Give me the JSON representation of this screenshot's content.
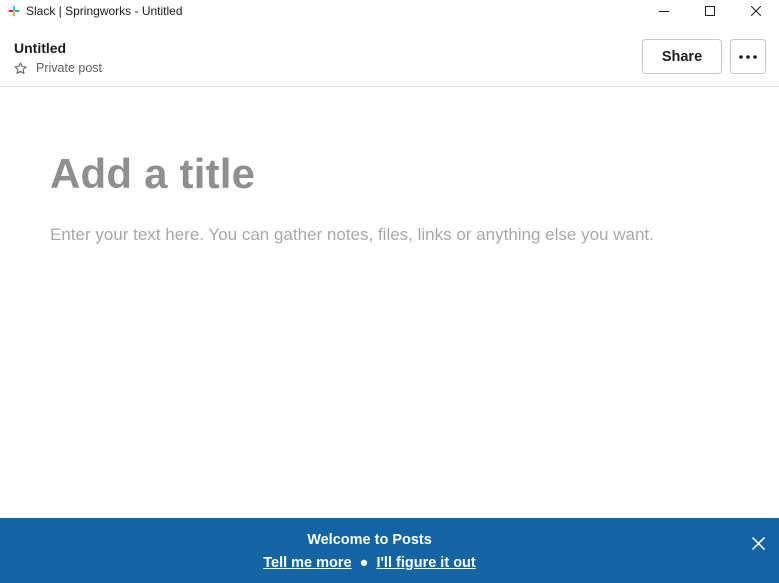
{
  "window": {
    "title": "Slack | Springworks - Untitled",
    "controls": [
      "minimize-icon",
      "maximize-icon",
      "close-icon"
    ]
  },
  "header": {
    "title": "Untitled",
    "visibility": "Private post",
    "share_label": "Share",
    "more_icon": "more-horizontal-icon"
  },
  "editor": {
    "title_placeholder": "Add a title",
    "body_placeholder": "Enter your text here. You can gather notes, files, links or anything else you want."
  },
  "banner": {
    "title": "Welcome to Posts",
    "link_more": "Tell me more",
    "separator": "●",
    "link_dismiss": "I'll figure it out",
    "background": "#1264a3"
  }
}
